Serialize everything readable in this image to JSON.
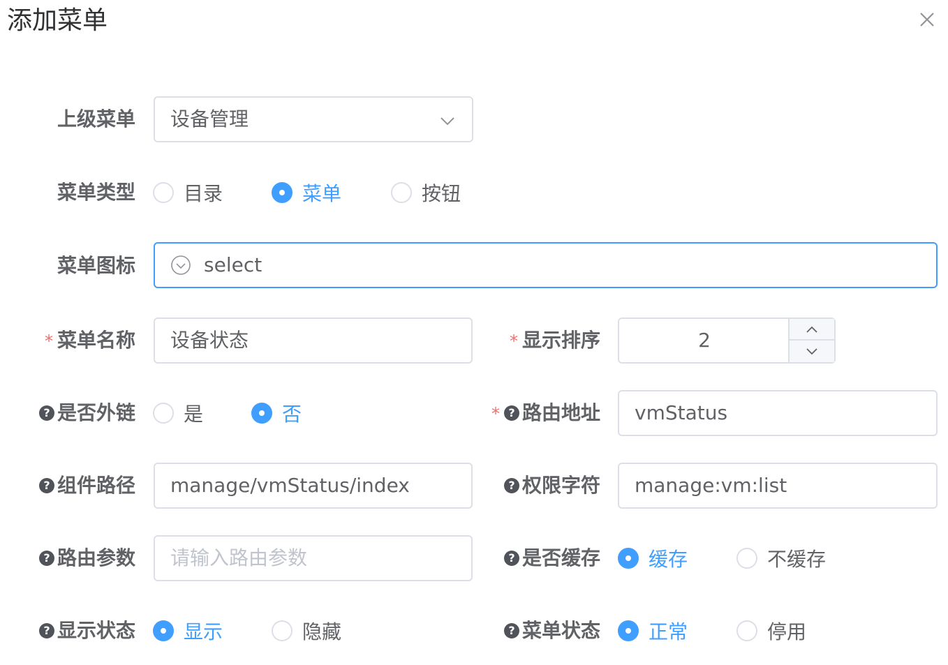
{
  "dialog": {
    "title": "添加菜单"
  },
  "fields": {
    "parent": {
      "label": "上级菜单",
      "value": "设备管理"
    },
    "menu_type": {
      "label": "菜单类型",
      "options": [
        "目录",
        "菜单",
        "按钮"
      ],
      "selected": "菜单"
    },
    "icon": {
      "label": "菜单图标",
      "value": "select"
    },
    "name": {
      "required": "*",
      "label": "菜单名称",
      "value": "设备状态"
    },
    "order": {
      "required": "*",
      "label": "显示排序",
      "value": "2"
    },
    "external": {
      "help": "?",
      "label": "是否外链",
      "options": [
        "是",
        "否"
      ],
      "selected": "否"
    },
    "route": {
      "required": "*",
      "help": "?",
      "label": "路由地址",
      "value": "vmStatus"
    },
    "component": {
      "help": "?",
      "label": "组件路径",
      "value": "manage/vmStatus/index"
    },
    "perms": {
      "help": "?",
      "label": "权限字符",
      "value": "manage:vm:list"
    },
    "query": {
      "help": "?",
      "label": "路由参数",
      "placeholder": "请输入路由参数"
    },
    "cache": {
      "help": "?",
      "label": "是否缓存",
      "options": [
        "缓存",
        "不缓存"
      ],
      "selected": "缓存"
    },
    "visible": {
      "help": "?",
      "label": "显示状态",
      "options": [
        "显示",
        "隐藏"
      ],
      "selected": "显示"
    },
    "status": {
      "help": "?",
      "label": "菜单状态",
      "options": [
        "正常",
        "停用"
      ],
      "selected": "正常"
    }
  },
  "colors": {
    "primary": "#409eff",
    "border": "#dcdfe6",
    "required": "#f56c6c",
    "text": "#606266",
    "placeholder": "#c0c4cc"
  }
}
